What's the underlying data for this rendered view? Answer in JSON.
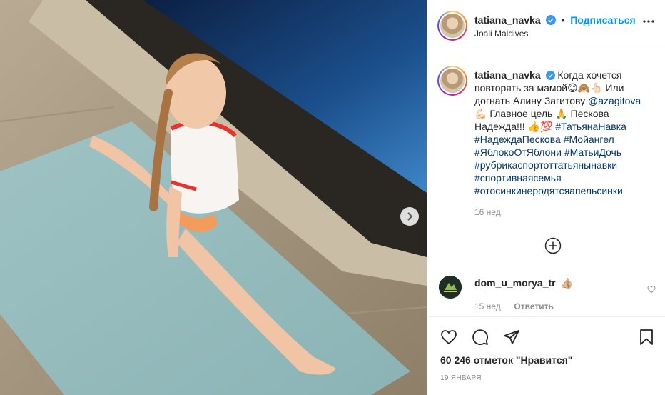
{
  "media": {
    "alt": "photo of a girl doing a split on a yoga mat by a pool"
  },
  "header": {
    "username": "tatiana_navka",
    "follow_label": "Подписаться",
    "follow_separator": "•",
    "location": "Joali Maldives",
    "more_icon": "more-horizontal-icon"
  },
  "caption": {
    "username": "tatiana_navka",
    "line1": "Когда хочется повторять за мамой😊🙈👆🏻 Или догнать Алину Загитову",
    "mention": "@azagitova",
    "line2": "💪🏻 Главное цель 🙏 Пескова Надежда!!! 👍💯",
    "hashtags": [
      "#ТатьянаНавка",
      "#НадеждаПескова",
      "#Мойангел",
      "#ЯблокоОтЯблони",
      "#МатьиДочь",
      "#рубрикаспортоттатьянынавки",
      "#спортивнаясемья",
      "#отосинкинеродятсяапельсинки"
    ],
    "time": "16 нед."
  },
  "comment": {
    "username": "dom_u_morya_tr",
    "text": "👍🏼",
    "time": "15 нед.",
    "reply_label": "Ответить"
  },
  "footer": {
    "likes": "60 246 отметок \"Нравится\"",
    "date": "19 ЯНВАРЯ"
  },
  "colors": {
    "link": "#00376b",
    "follow": "#0095f6",
    "verified": "#3897f0",
    "muted": "#8e8e8e"
  }
}
